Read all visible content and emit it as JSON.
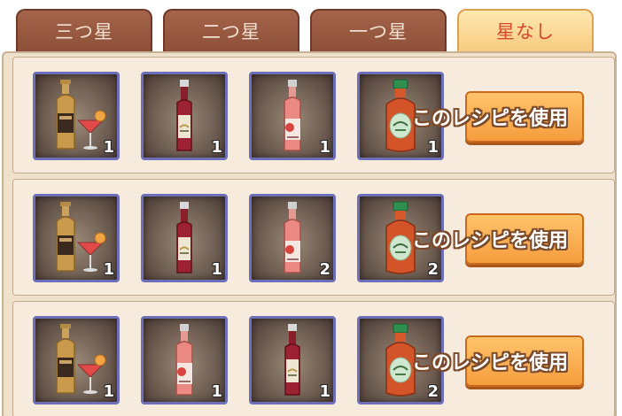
{
  "tabs": [
    {
      "label": "三つ星",
      "active": false
    },
    {
      "label": "二つ星",
      "active": false
    },
    {
      "label": "一つ星",
      "active": false
    },
    {
      "label": "星なし",
      "active": true
    }
  ],
  "use_button_label": "このレシピを使用",
  "recipes": [
    {
      "ingredients": [
        {
          "icon": "cocktail-whiskey-icon",
          "count": "1"
        },
        {
          "icon": "red-liqueur-bottle-icon",
          "count": "1"
        },
        {
          "icon": "pink-rose-bottle-icon",
          "count": "1"
        },
        {
          "icon": "green-cap-juice-bottle-icon",
          "count": "1"
        }
      ]
    },
    {
      "ingredients": [
        {
          "icon": "cocktail-whiskey-icon",
          "count": "1"
        },
        {
          "icon": "red-liqueur-bottle-icon",
          "count": "1"
        },
        {
          "icon": "pink-rose-bottle-icon",
          "count": "2"
        },
        {
          "icon": "green-cap-juice-bottle-icon",
          "count": "2"
        }
      ]
    },
    {
      "ingredients": [
        {
          "icon": "cocktail-whiskey-icon",
          "count": "1"
        },
        {
          "icon": "pink-rose-bottle-icon",
          "count": "1"
        },
        {
          "icon": "red-liqueur-bottle-icon",
          "count": "1"
        },
        {
          "icon": "green-cap-juice-bottle-icon",
          "count": "2"
        }
      ]
    }
  ]
}
